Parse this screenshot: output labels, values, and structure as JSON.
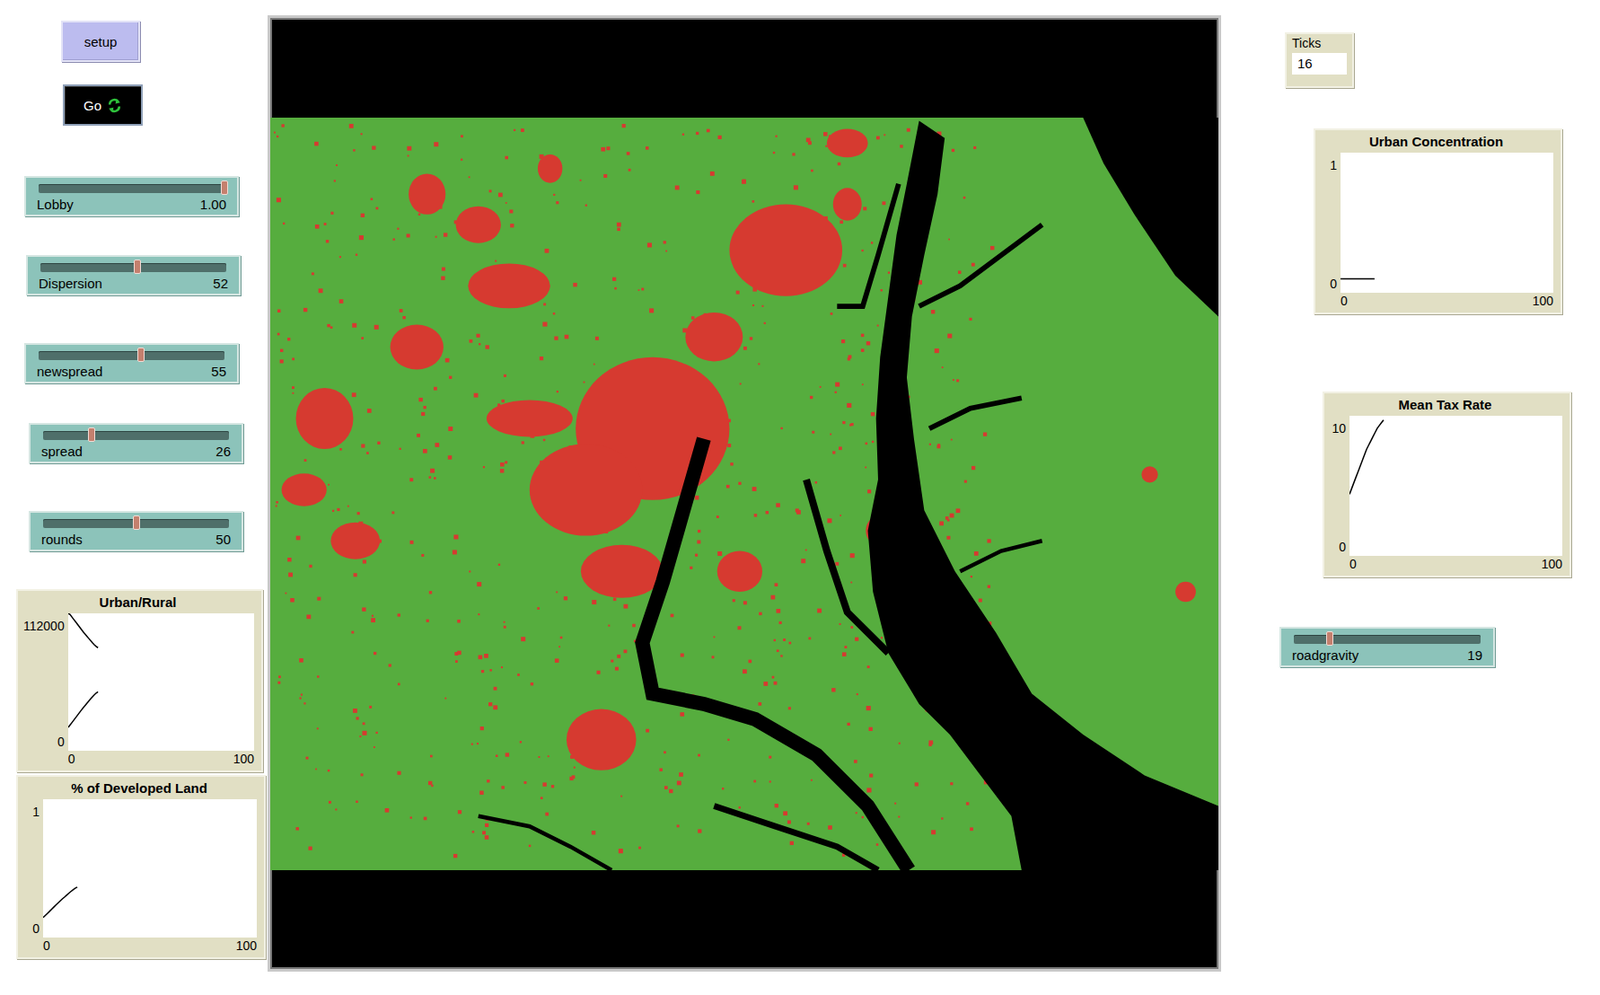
{
  "buttons": [
    {
      "label": "setup",
      "kind": "once",
      "pressed": false
    },
    {
      "label": "Go",
      "kind": "forever",
      "pressed": true
    }
  ],
  "sliders": [
    {
      "label": "Lobby",
      "value": "1.00",
      "level": 1.0
    },
    {
      "label": "Dispersion",
      "value": "52",
      "level": 0.52
    },
    {
      "label": "newspread",
      "value": "55",
      "level": 0.55
    },
    {
      "label": "spread",
      "value": "26",
      "level": 0.26
    },
    {
      "label": "rounds",
      "value": "50",
      "level": 0.5
    }
  ],
  "left_plots": [
    {
      "title": "Urban/Rural",
      "y_min": "0",
      "y_max": "112000",
      "x_min": "0",
      "x_max": "100",
      "series": [
        {
          "values": [
            112000,
            111000,
            109000,
            107000,
            105000,
            103000,
            101000,
            99000,
            97000,
            95200,
            93400,
            91600,
            89800,
            88000,
            86400,
            85000,
            84000
          ]
        },
        {
          "values": [
            19000,
            21000,
            23000,
            25000,
            27000,
            29000,
            31000,
            33000,
            35000,
            36800,
            38600,
            40400,
            42200,
            44000,
            45600,
            47000,
            48000
          ]
        }
      ]
    },
    {
      "title": "% of Developed Land",
      "y_min": "0",
      "y_max": "1",
      "x_min": "0",
      "x_max": "100",
      "series": [
        {
          "values": [
            0.144,
            0.159,
            0.174,
            0.189,
            0.205,
            0.22,
            0.235,
            0.25,
            0.265,
            0.279,
            0.292,
            0.306,
            0.32,
            0.333,
            0.345,
            0.356,
            0.364
          ]
        }
      ]
    }
  ],
  "monitor": {
    "label": "Ticks",
    "value": "16"
  },
  "right_plots": [
    {
      "title": "Urban Concentration",
      "y_min": "0",
      "y_max": "1",
      "x_min": "0",
      "x_max": "100",
      "series": [
        {
          "values": [
            0.1,
            0.1,
            0.1,
            0.1,
            0.1,
            0.1,
            0.1,
            0.1,
            0.1,
            0.1,
            0.1,
            0.1,
            0.1,
            0.1,
            0.1,
            0.1,
            0.1
          ]
        }
      ]
    },
    {
      "title": "Mean Tax Rate",
      "y_min": "0",
      "y_max": "10",
      "x_min": "0",
      "x_max": "100",
      "series": [
        {
          "values": [
            4.4,
            4.8,
            5.2,
            5.6,
            6.0,
            6.4,
            6.8,
            7.2,
            7.6,
            7.9,
            8.2,
            8.5,
            8.8,
            9.1,
            9.3,
            9.5,
            9.7
          ]
        }
      ]
    }
  ],
  "side_sliders": [
    {
      "label": "roadgravity",
      "value": "19",
      "level": 0.19
    }
  ]
}
